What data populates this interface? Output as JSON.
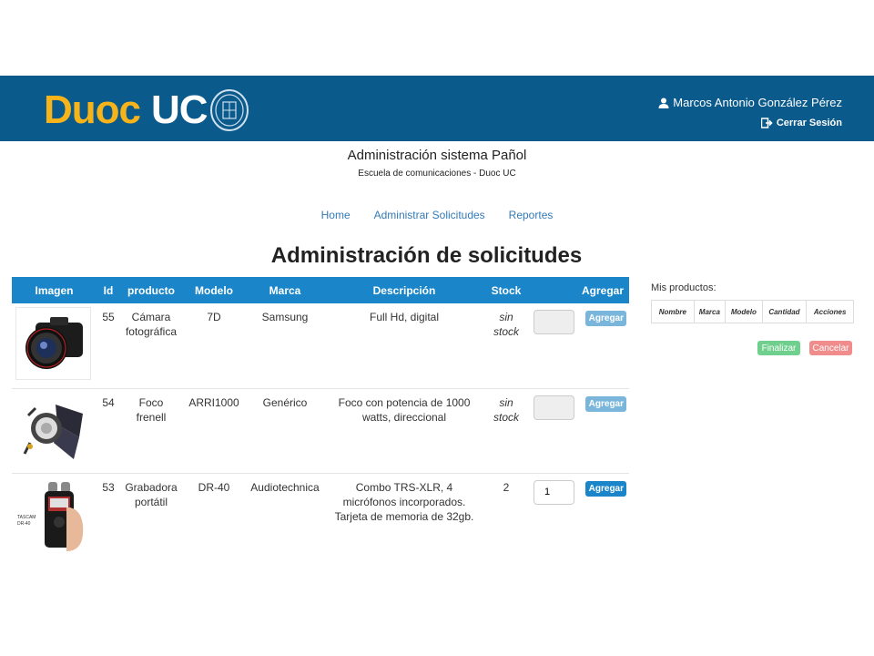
{
  "header": {
    "logo_duoc": "Duoc",
    "logo_uc": "UC",
    "user_name": "Marcos Antonio González Pérez",
    "logout_label": "Cerrar Sesión"
  },
  "system": {
    "title": "Administración sistema Pañol",
    "subtitle": "Escuela de comunicaciones - Duoc UC"
  },
  "nav": {
    "home": "Home",
    "admin_requests": "Administrar Solicitudes",
    "reports": "Reportes"
  },
  "page_title": "Administración de solicitudes",
  "table": {
    "headers": [
      "Imagen",
      "Id",
      "producto",
      "Modelo",
      "Marca",
      "Descripción",
      "Stock",
      "Agregar"
    ],
    "rows": [
      {
        "image_icon": "camera-image",
        "id": "55",
        "product_line1": "Cámara",
        "product_line2": "fotográfica",
        "model": "7D",
        "brand": "Samsung",
        "description": "Full Hd, digital",
        "stock_line1": "sin",
        "stock_line2": "stock",
        "qty": "",
        "add_label": "Agregar"
      },
      {
        "image_icon": "fresnel-light-image",
        "id": "54",
        "product_line1": "Foco",
        "product_line2": "frenell",
        "model": "ARRI1000",
        "brand": "Genérico",
        "description": "Foco con potencia de 1000 watts, direccional",
        "stock_line1": "sin",
        "stock_line2": "stock",
        "qty": "",
        "add_label": "Agregar"
      },
      {
        "image_icon": "audio-recorder-image",
        "image_label_1": "TASCAM",
        "image_label_2": "DR-40",
        "id": "53",
        "product_line1": "Grabadora",
        "product_line2": "portátil",
        "model": "DR-40",
        "brand": "Audiotechnica",
        "description": "Combo TRS-XLR, 4 micrófonos incorporados. Tarjeta de memoria de 32gb.",
        "stock": "2",
        "qty": "1",
        "add_label": "Agregar"
      }
    ]
  },
  "my_products": {
    "title": "Mis productos:",
    "headers": [
      "Nombre",
      "Marca",
      "Modelo",
      "Cantidad",
      "Acciones"
    ],
    "finish_label": "Finalizar",
    "cancel_label": "Cancelar"
  },
  "colors": {
    "header_bg": "#0b5a8c",
    "logo_yellow": "#f7b41a",
    "table_header": "#1a85c9",
    "finish": "#6fcf8c",
    "cancel": "#f08c8c"
  }
}
